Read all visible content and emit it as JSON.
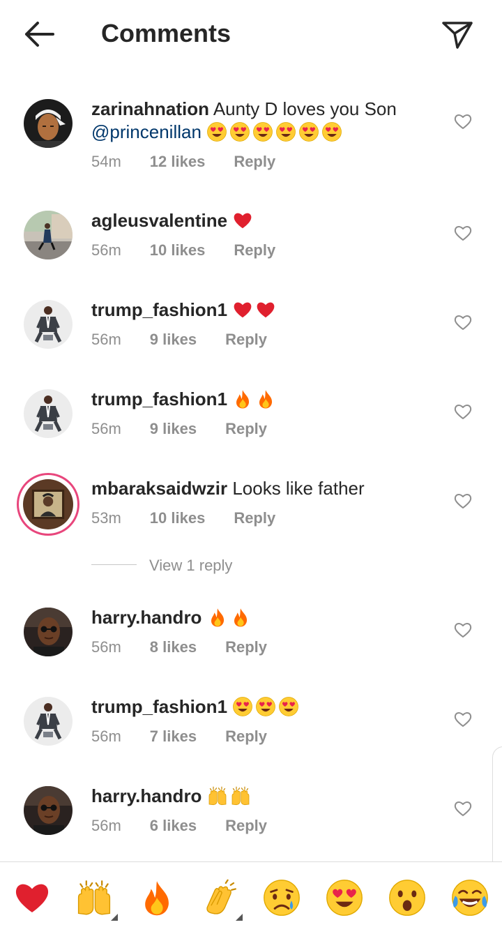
{
  "header": {
    "title": "Comments",
    "back_icon": "arrow-left-icon",
    "send_icon": "send-icon"
  },
  "comments": [
    {
      "username": "zarinahnation",
      "text": "Aunty D loves you Son",
      "mention": "@princenillan",
      "emojis": [
        "heart-eyes",
        "heart-eyes",
        "heart-eyes",
        "heart-eyes",
        "heart-eyes",
        "heart-eyes"
      ],
      "time": "54m",
      "likes": "12 likes",
      "reply": "Reply",
      "avatar": "bandana-portrait"
    },
    {
      "username": "agleusvalentine",
      "text": "",
      "mention": "",
      "emojis": [
        "red-heart"
      ],
      "time": "56m",
      "likes": "10 likes",
      "reply": "Reply",
      "avatar": "street-photo"
    },
    {
      "username": "trump_fashion1",
      "text": "",
      "mention": "",
      "emojis": [
        "red-heart",
        "red-heart"
      ],
      "time": "56m",
      "likes": "9 likes",
      "reply": "Reply",
      "avatar": "seated-figure"
    },
    {
      "username": "trump_fashion1",
      "text": "",
      "mention": "",
      "emojis": [
        "fire",
        "fire"
      ],
      "time": "56m",
      "likes": "9 likes",
      "reply": "Reply",
      "avatar": "seated-figure"
    },
    {
      "username": "mbaraksaidwzir",
      "text": "Looks like father",
      "mention": "",
      "emojis": [],
      "time": "53m",
      "likes": "10 likes",
      "reply": "Reply",
      "avatar": "framed-portrait",
      "story_ring": true
    },
    {
      "username": "harry.handro",
      "text": "",
      "mention": "",
      "emojis": [
        "fire",
        "fire"
      ],
      "time": "56m",
      "likes": "8 likes",
      "reply": "Reply",
      "avatar": "sunglasses-portrait"
    },
    {
      "username": "trump_fashion1",
      "text": "",
      "mention": "",
      "emojis": [
        "heart-eyes",
        "heart-eyes",
        "heart-eyes"
      ],
      "time": "56m",
      "likes": "7 likes",
      "reply": "Reply",
      "avatar": "seated-figure"
    },
    {
      "username": "harry.handro",
      "text": "",
      "mention": "",
      "emojis": [
        "raising-hands",
        "raising-hands"
      ],
      "time": "56m",
      "likes": "6 likes",
      "reply": "Reply",
      "avatar": "sunglasses-portrait"
    }
  ],
  "view_replies": "View 1 reply",
  "quick_reactions": [
    "red-heart",
    "raising-hands",
    "fire",
    "clapping-hands",
    "sad-relieved",
    "heart-eyes",
    "surprised",
    "tears-of-joy"
  ],
  "colors": {
    "text": "#262626",
    "secondary": "#8e8e8e",
    "mention": "#00376b",
    "story_ring": "#e8467c"
  }
}
